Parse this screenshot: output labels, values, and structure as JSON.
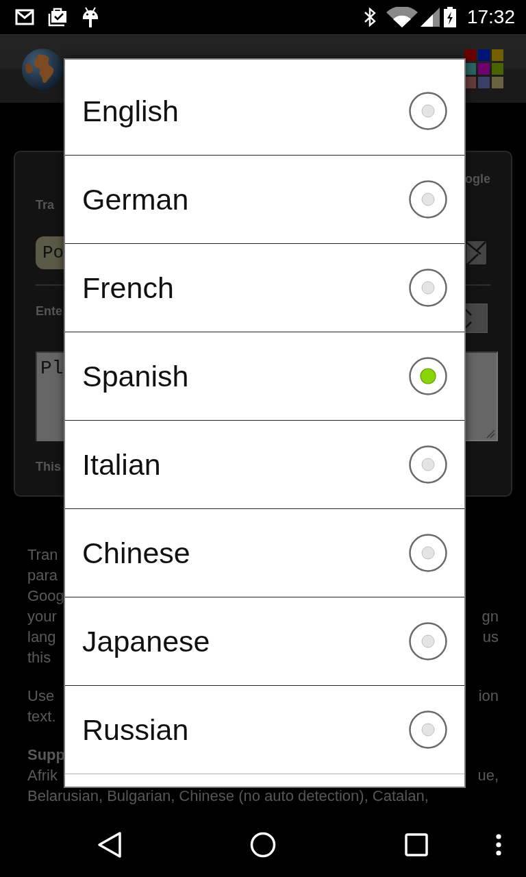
{
  "status_bar": {
    "time": "17:32"
  },
  "card": {
    "label_top_right": "ogle",
    "label_1": "Tra",
    "field_value": "Po",
    "label_2": "Ente",
    "text_area_value": "Pl",
    "note": "This"
  },
  "body": [
    {
      "kind": "paragraph",
      "lines": [
        {
          "text": "Tran"
        },
        {
          "text": "para"
        },
        {
          "text": "Goog"
        },
        {
          "text": "your",
          "end_text": "gn"
        },
        {
          "text": "lang",
          "end_text": "us"
        },
        {
          "text": "this"
        }
      ]
    },
    {
      "kind": "paragraph",
      "lines": [
        {
          "text": "Use",
          "end_text": "ion"
        },
        {
          "text": "text."
        }
      ]
    },
    {
      "kind": "heading",
      "lines": [
        {
          "text": "Supp"
        }
      ]
    },
    {
      "kind": "paragraph",
      "lines": [
        {
          "text": "Afrik",
          "end_text": "ue,"
        },
        {
          "text": "Belarusian, Bulgarian, Chinese (no auto detection), Catalan,"
        }
      ]
    }
  ],
  "dialog": {
    "options": [
      {
        "label": "English",
        "selected": false
      },
      {
        "label": "German",
        "selected": false
      },
      {
        "label": "French",
        "selected": false
      },
      {
        "label": "Spanish",
        "selected": true
      },
      {
        "label": "Italian",
        "selected": false
      },
      {
        "label": "Chinese",
        "selected": false
      },
      {
        "label": "Japanese",
        "selected": false
      },
      {
        "label": "Russian",
        "selected": false
      }
    ]
  }
}
